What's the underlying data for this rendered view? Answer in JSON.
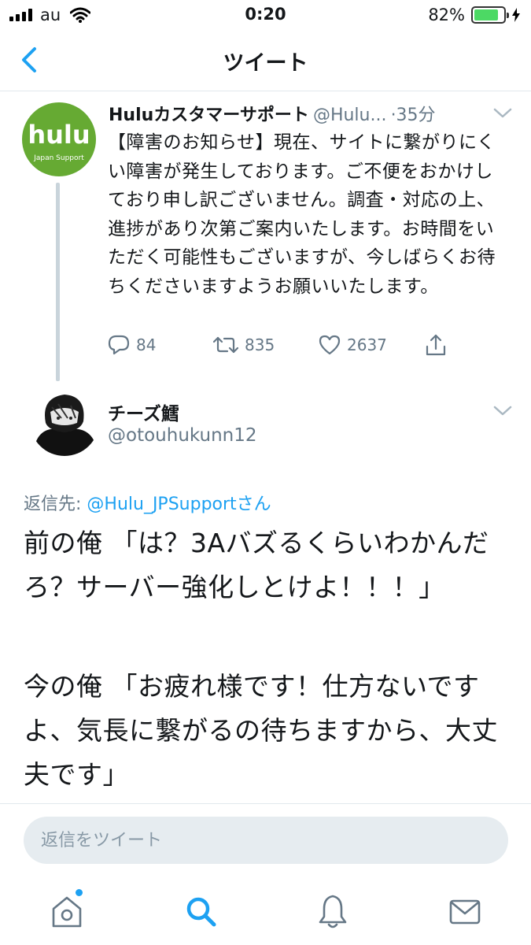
{
  "status_bar": {
    "carrier": "au",
    "time": "0:20",
    "battery_percent_text": "82%",
    "battery_level": 0.82
  },
  "nav": {
    "title": "ツイート"
  },
  "parent_tweet": {
    "avatar_logo": "hulu",
    "avatar_sub": "Japan Support",
    "name": "Huluカスタマーサポート",
    "handle": "@Hulu...",
    "time": "·35分",
    "text": "【障害のお知らせ】現在、サイトに繋がりにくい障害が発生しております。ご不便をおかけしており申し訳ございません。調査・対応の上、進捗があり次第ご案内いたします。お時間をいただく可能性もございますが、今しばらくお待ちくださいますようお願いいたします。",
    "reply_count": "84",
    "retweet_count": "835",
    "like_count": "2637"
  },
  "reply_tweet": {
    "name": "チーズ鱈",
    "handle": "@otouhukunn12",
    "reply_to_prefix": "返信先: ",
    "reply_to_mention": "@Hulu_JPSupportさん",
    "paragraph_1": "前の俺 「は？3Aバズるくらいわかんだろ？サーバー強化しとけよ！！！」",
    "paragraph_2": "今の俺 「お疲れ様です！仕方ないですよ、気長に繋がるの待ちますから、大丈夫です」"
  },
  "reply_bar": {
    "placeholder": "返信をツイート"
  },
  "tabs": [
    "home-icon",
    "search-icon",
    "bell-icon",
    "mail-icon"
  ],
  "colors": {
    "accent": "#1da1f2",
    "hulu_green": "#66aa33",
    "secondary_text": "#657786",
    "battery_green": "#4cd964"
  }
}
